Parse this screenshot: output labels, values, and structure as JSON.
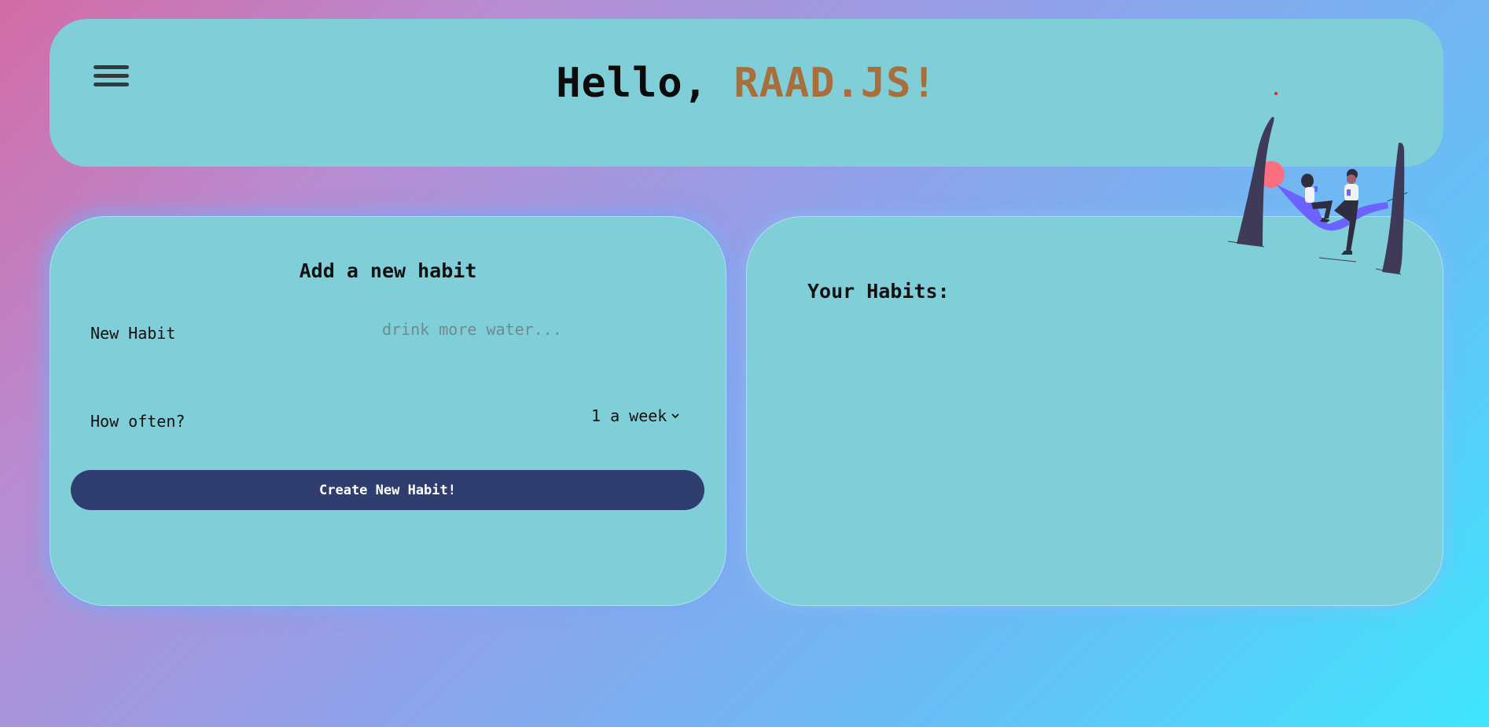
{
  "header": {
    "greeting_prefix": "Hello, ",
    "username": "RAAD.JS!",
    "menu_icon": "hamburger-menu-icon"
  },
  "colors": {
    "accent": "#a86e3c",
    "panel": "#80cfd8",
    "button": "#2e3e6e"
  },
  "add_habit": {
    "title": "Add a new habit",
    "habit_label": "New Habit",
    "habit_placeholder": "drink more water...",
    "habit_value": "",
    "frequency_label": "How often?",
    "frequency_selected": "1 a week",
    "create_button": "Create New Habit!"
  },
  "habits": {
    "title": "Your Habits:",
    "items": []
  },
  "illustration": {
    "icon": "hammock-people-illustration"
  }
}
